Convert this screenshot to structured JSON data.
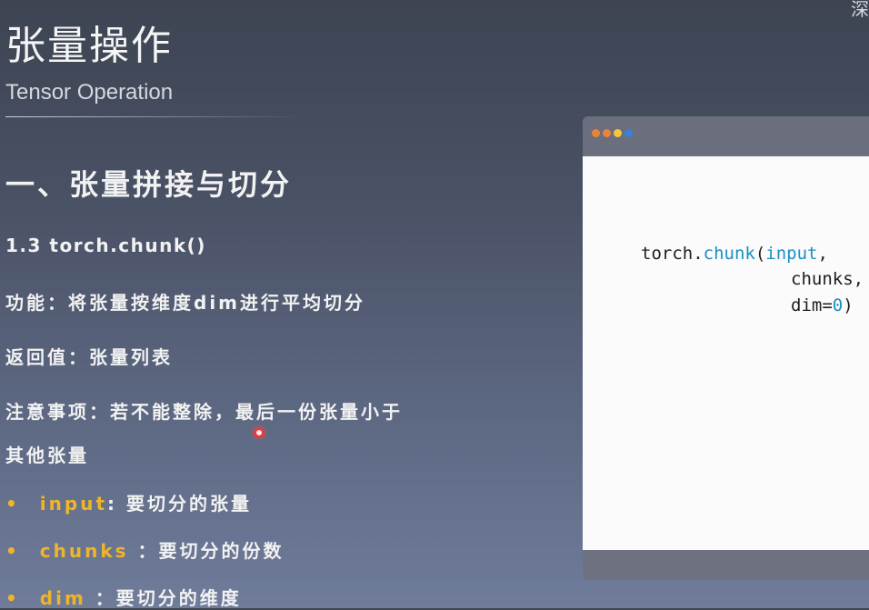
{
  "corner_text": "深",
  "title": "张量操作",
  "subtitle": "Tensor Operation",
  "section_heading": "一、张量拼接与切分",
  "function_heading": "1.3 torch.chunk()",
  "function_line": "功能：将张量按维度dim进行平均切分",
  "return_line": "返回值：张量列表",
  "note_line_1": "注意事项：若不能整除，最后一份张量小于",
  "note_line_2": "其他张量",
  "bullet_marker": "•",
  "params": [
    {
      "name": "input",
      "desc": ": 要切分的张量"
    },
    {
      "name": "chunks",
      "desc": " ：要切分的份数"
    },
    {
      "name": "dim",
      "desc": " ：要切分的维度"
    }
  ],
  "code": {
    "line1_prefix": "torch.",
    "line1_fn": "chunk",
    "line1_paren": "(",
    "line1_arg": "input",
    "line1_suffix": ",",
    "line2": "chunks,",
    "line3_prefix": "dim=",
    "line3_num": "0",
    "line3_suffix": ")"
  },
  "colors": {
    "accent": "#f0b429",
    "code_keyword": "#1a8fc2",
    "window_dot_orange": "#e8843a",
    "window_dot_yellow": "#f3c63c",
    "window_dot_blue": "#3b7fd9"
  }
}
